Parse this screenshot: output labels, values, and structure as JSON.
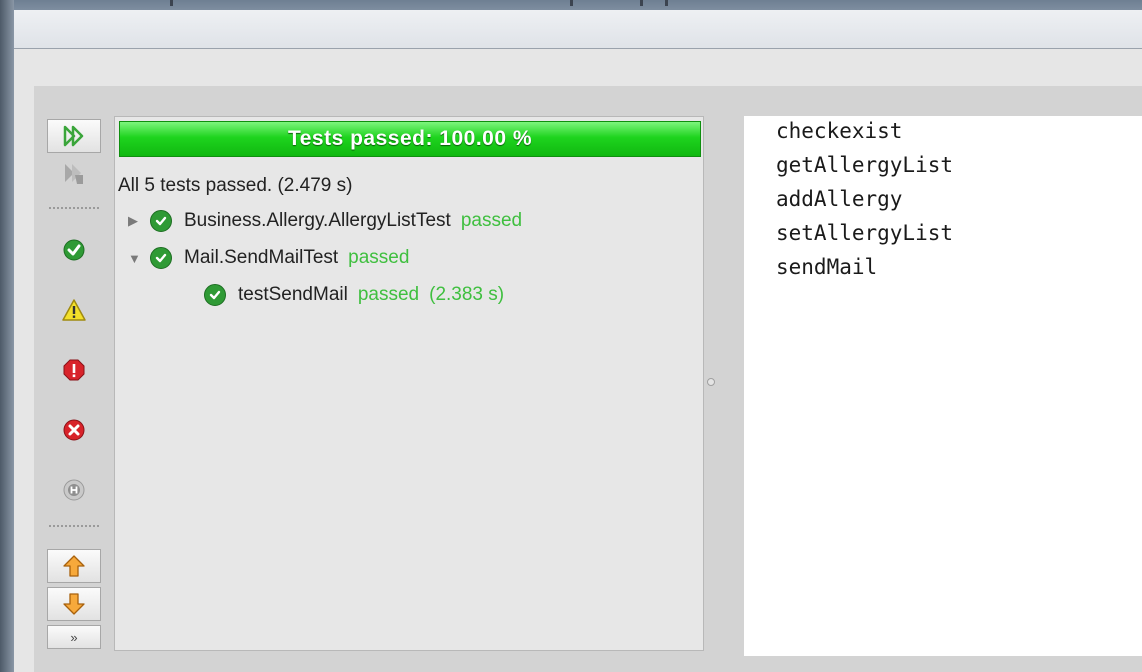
{
  "progress": {
    "label": "Tests passed: 100.00 %",
    "percent": 100,
    "color": "#1ed41e"
  },
  "summary": "All 5 tests passed. (2.479 s)",
  "tree": [
    {
      "name": "Business.Allergy.AllergyListTest",
      "status": "passed",
      "expanded": false
    },
    {
      "name": "Mail.SendMailTest",
      "status": "passed",
      "expanded": true
    },
    {
      "name": "testSendMail",
      "status": "passed",
      "time": "(2.383 s)"
    }
  ],
  "toolbar": {
    "icons": [
      "rerun-icon",
      "rerun-failed-icon",
      "show-passed-icon",
      "show-warnings-icon",
      "show-errors-icon",
      "show-failures-icon",
      "show-skipped-icon",
      "previous-failure-icon",
      "next-failure-icon"
    ],
    "more_label": "»"
  },
  "output": {
    "lines": [
      "checkexist",
      "getAllergyList",
      "addAllergy",
      "setAllergyList",
      "sendMail"
    ]
  },
  "colors": {
    "passed_text": "#3fbf3f",
    "check_green": "#2f9a35"
  }
}
